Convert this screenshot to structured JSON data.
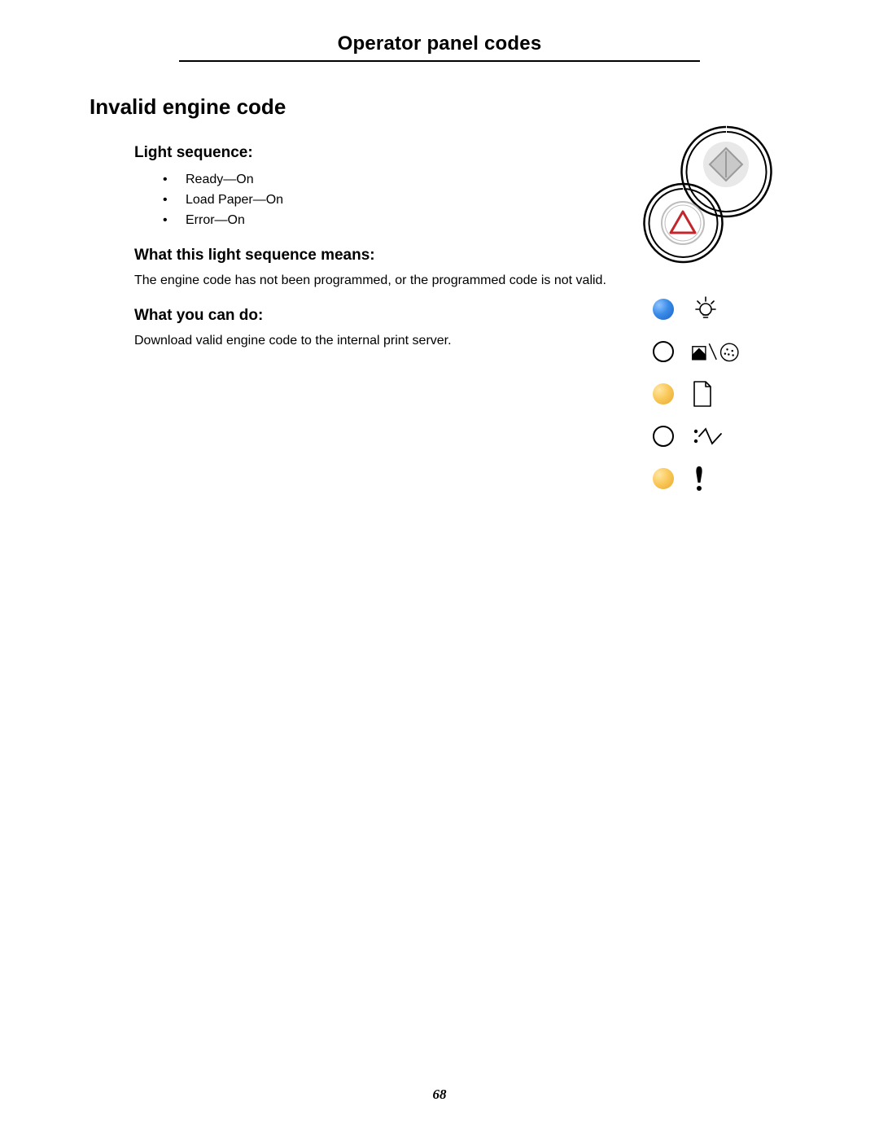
{
  "header": "Operator panel codes",
  "section_title": "Invalid engine code",
  "light_sequence": {
    "heading": "Light sequence:",
    "items": [
      "Ready—On",
      "Load Paper—On",
      "Error—On"
    ]
  },
  "means": {
    "heading": "What this light sequence means:",
    "body": "The engine code has not been programmed, or the programmed code is not valid."
  },
  "do": {
    "heading": "What you can do:",
    "body": "Download valid engine code to the internal print server."
  },
  "page_number": "68",
  "panel": {
    "buttons": {
      "go_pressed": false,
      "cancel_pressed": false
    },
    "lights": [
      {
        "name": "ready",
        "state": "on",
        "color": "blue"
      },
      {
        "name": "toner",
        "state": "off",
        "color": "off"
      },
      {
        "name": "load-paper",
        "state": "on",
        "color": "amber"
      },
      {
        "name": "paper-jam",
        "state": "off",
        "color": "off"
      },
      {
        "name": "error",
        "state": "on",
        "color": "amber"
      }
    ]
  }
}
